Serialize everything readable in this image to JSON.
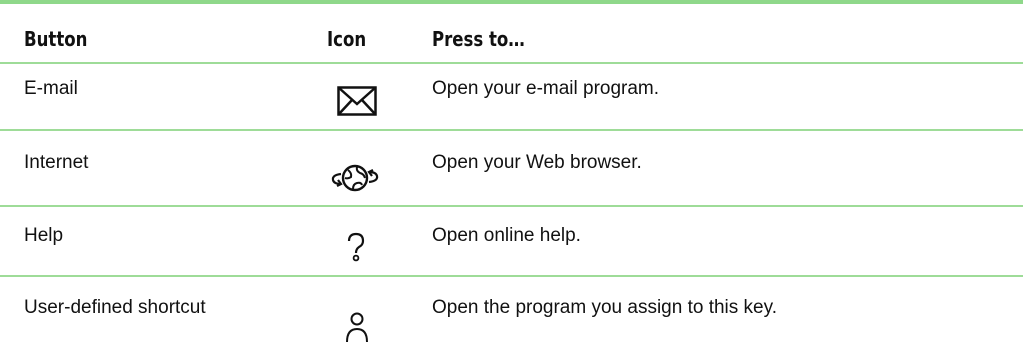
{
  "table": {
    "headers": {
      "button": "Button",
      "icon": "Icon",
      "press": "Press to…"
    },
    "rows": [
      {
        "button": "E-mail",
        "icon": "envelope-icon",
        "press": "Open your e-mail program."
      },
      {
        "button": "Internet",
        "icon": "globe-arrows-icon",
        "press": "Open your Web browser."
      },
      {
        "button": "Help",
        "icon": "question-mark-icon",
        "press": "Open online help."
      },
      {
        "button": "User-defined shortcut",
        "icon": "person-icon",
        "press": "Open the program you assign to this key."
      }
    ]
  },
  "colors": {
    "rule": "#8fd88a"
  }
}
